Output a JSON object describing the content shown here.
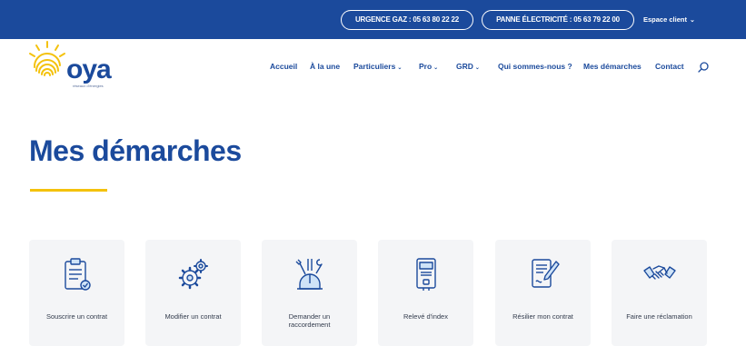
{
  "topbar": {
    "urgence_gaz": "URGENCE GAZ : 05 63 80 22 22",
    "panne_elec": "PANNE ÉLECTRICITÉ : 05 63 79 22 00",
    "espace_client": "Espace client"
  },
  "logo": {
    "word": "oya",
    "tagline": "réseaux d'énergies"
  },
  "nav": {
    "items": [
      {
        "label": "Accueil",
        "caret": false
      },
      {
        "label": "À la une",
        "caret": false
      },
      {
        "label": "Particuliers",
        "caret": true
      },
      {
        "label": "Pro",
        "caret": true
      },
      {
        "label": "GRD",
        "caret": true
      },
      {
        "label": "Qui sommes-nous ?",
        "caret": false
      },
      {
        "label": "Mes démarches",
        "caret": false
      },
      {
        "label": "Contact",
        "caret": false
      }
    ]
  },
  "page": {
    "title": "Mes démarches"
  },
  "cards": [
    {
      "label": "Souscrire un contrat",
      "icon": "clipboard-check-icon"
    },
    {
      "label": "Modifier un contrat",
      "icon": "gears-icon"
    },
    {
      "label": "Demander un raccordement",
      "icon": "tools-helmet-icon"
    },
    {
      "label": "Relevé d'index",
      "icon": "meter-icon"
    },
    {
      "label": "Résilier mon contrat",
      "icon": "document-pen-icon"
    },
    {
      "label": "Faire une réclamation",
      "icon": "handshake-icon"
    }
  ],
  "colors": {
    "brand_blue": "#1b4a9c",
    "accent_yellow": "#f4c20d",
    "card_bg": "#f4f5f7"
  }
}
